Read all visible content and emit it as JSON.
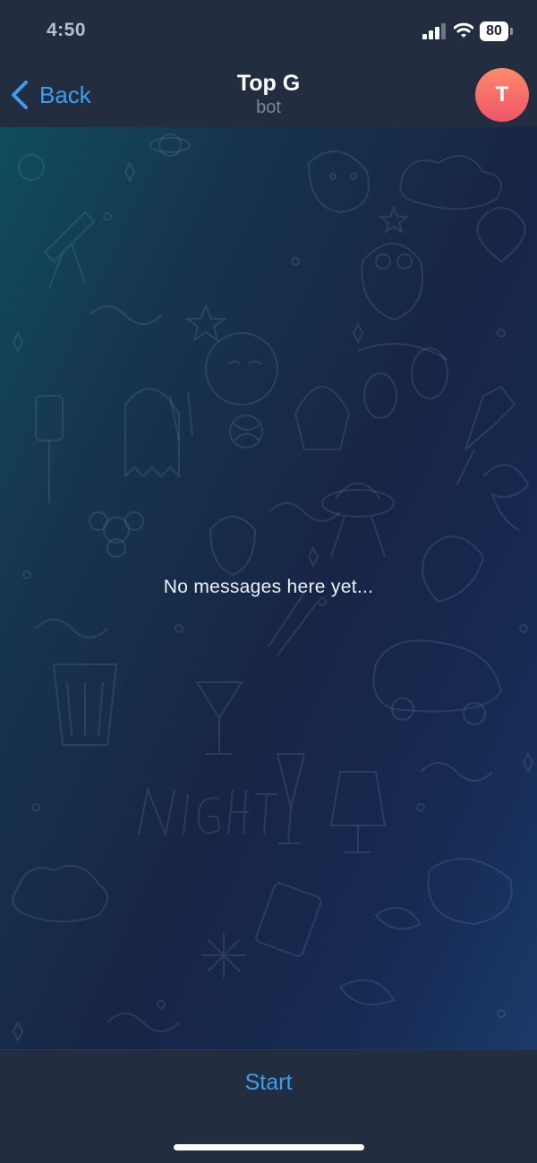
{
  "status_bar": {
    "time": "4:50",
    "battery": "80",
    "icons": [
      "signal-icon",
      "wifi-icon",
      "battery-icon"
    ]
  },
  "header": {
    "back_label": "Back",
    "title": "Top G",
    "subtitle": "bot",
    "avatar_initial": "T"
  },
  "chat": {
    "empty_message": "No messages here yet..."
  },
  "footer": {
    "start_label": "Start"
  },
  "colors": {
    "accent": "#3d9ef0",
    "bar_background": "#222d40",
    "avatar_gradient_top": "#ff8a6a",
    "avatar_gradient_bottom": "#f0546a"
  }
}
